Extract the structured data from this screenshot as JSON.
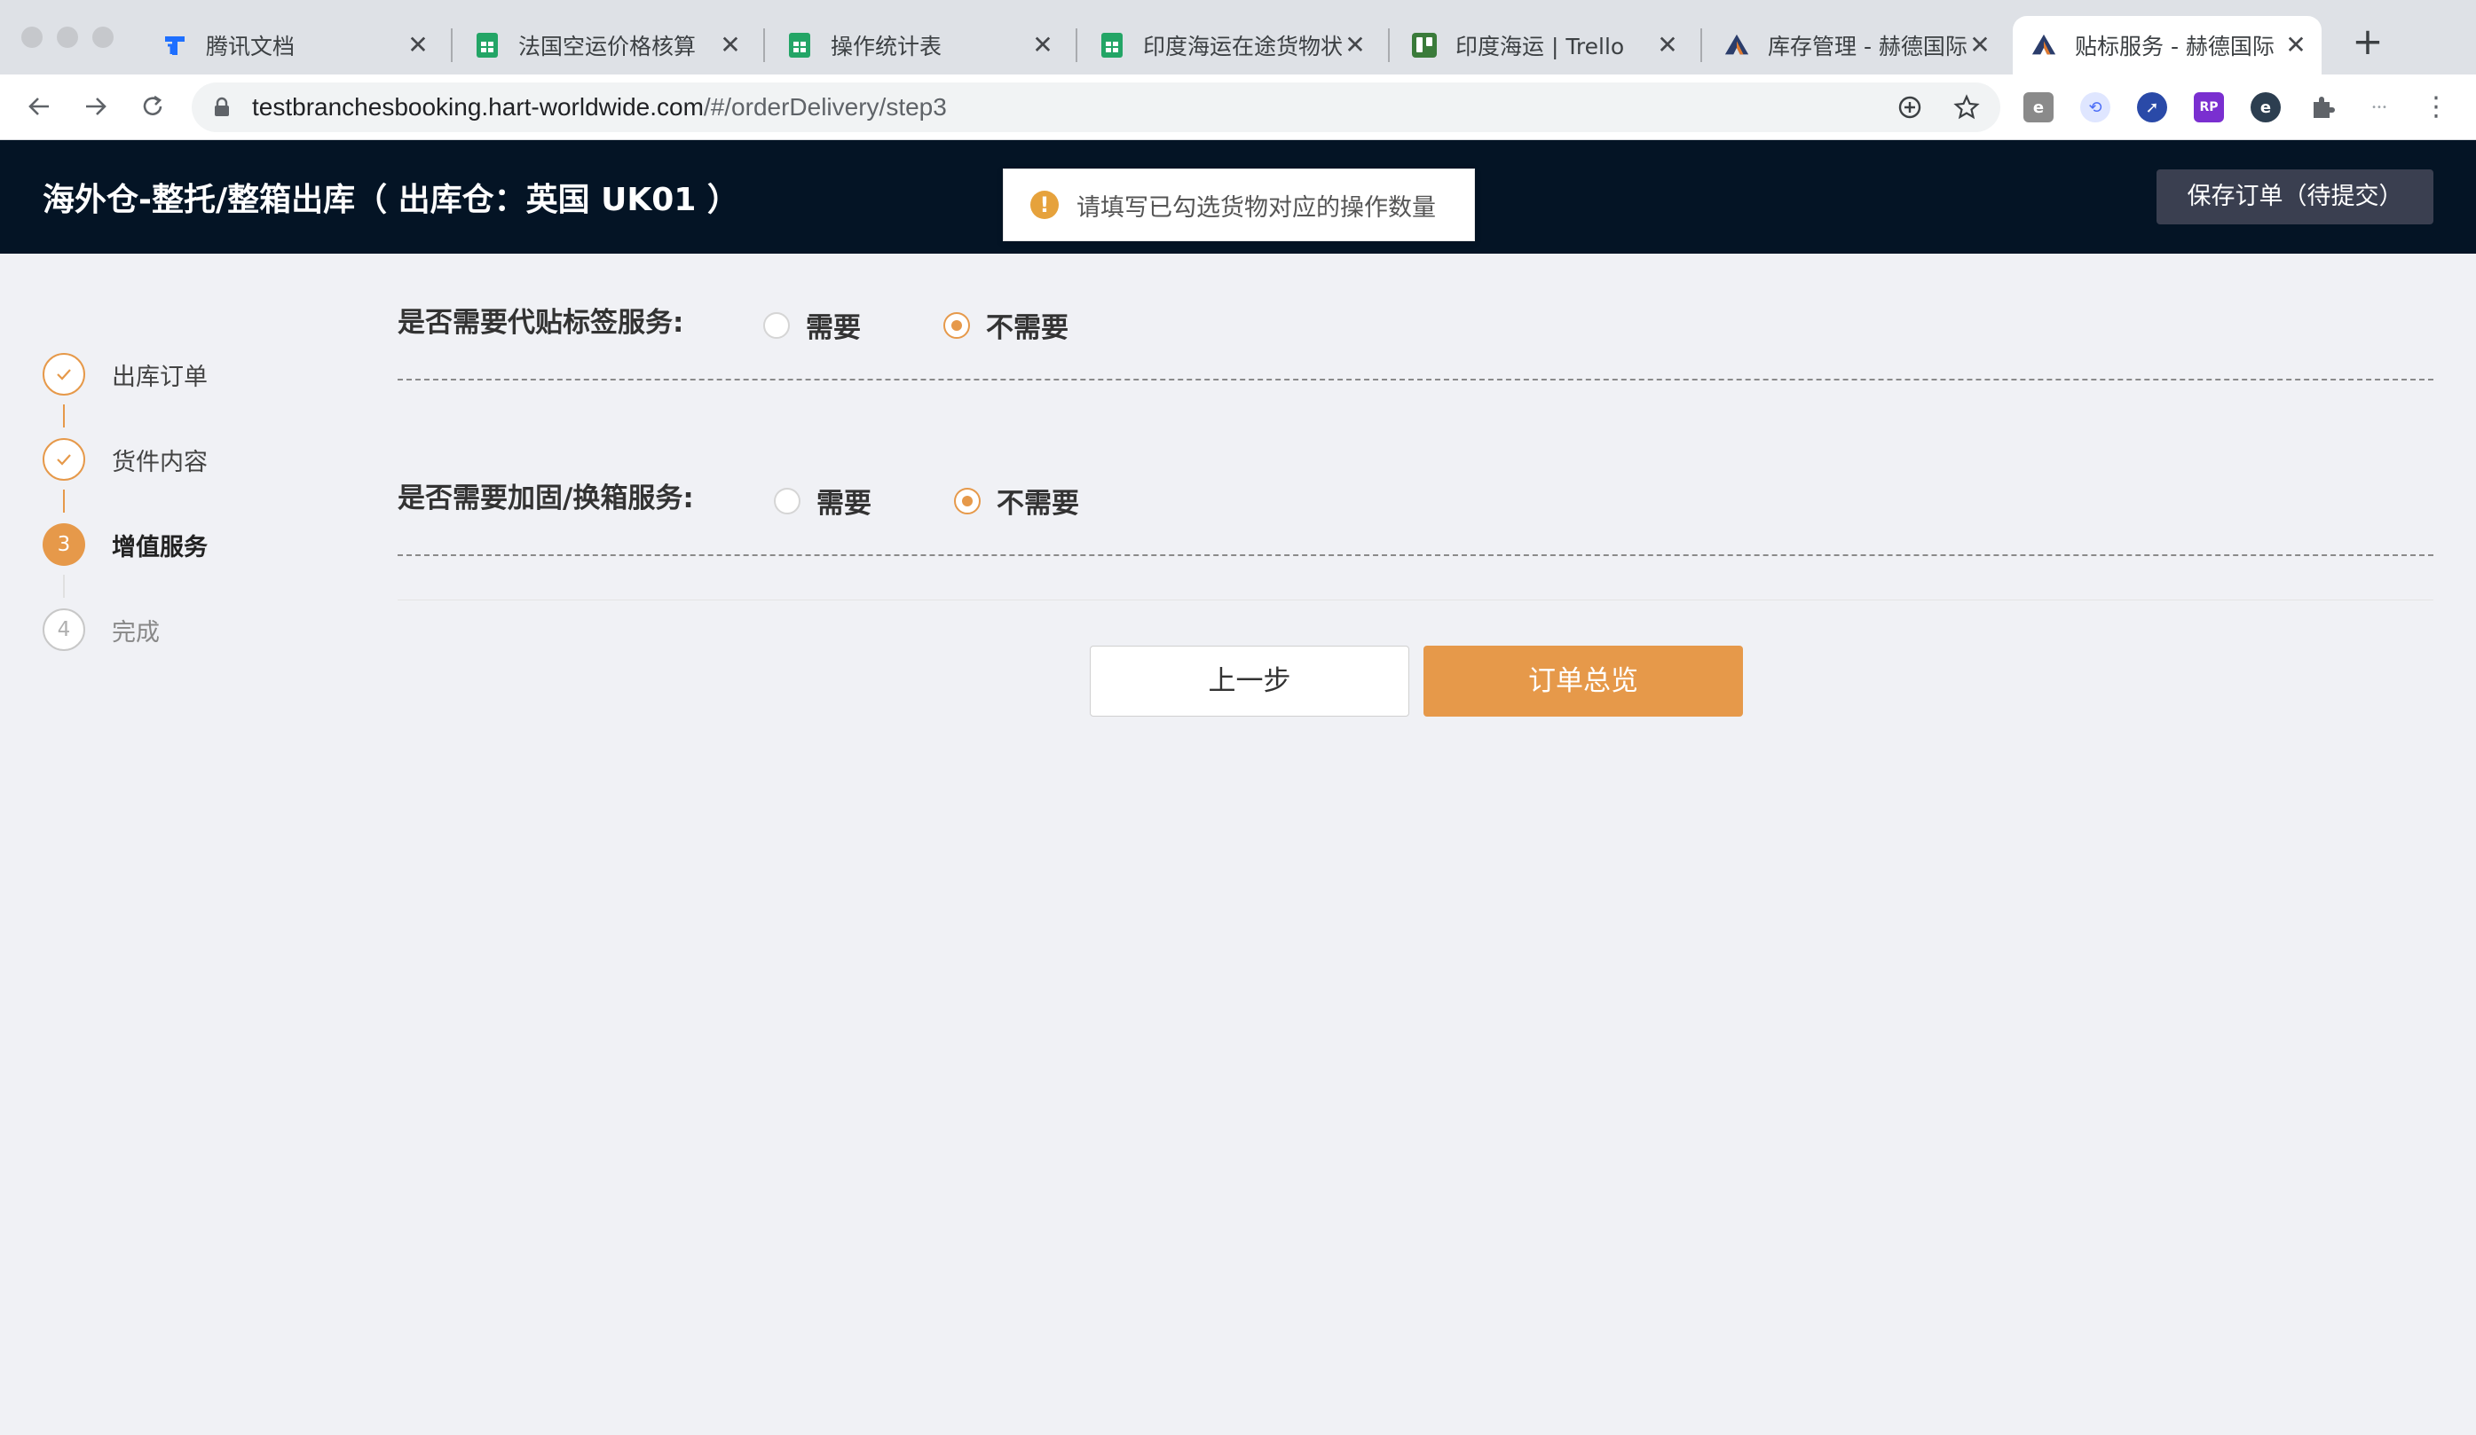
{
  "browser": {
    "tabs": [
      {
        "title": "腾讯文档",
        "icon": "tencent-docs-icon"
      },
      {
        "title": "法国空运价格核算",
        "icon": "sheet-icon"
      },
      {
        "title": "操作统计表",
        "icon": "sheet-icon"
      },
      {
        "title": "印度海运在途货物状",
        "icon": "sheet-icon"
      },
      {
        "title": "印度海运 | Trello",
        "icon": "trello-icon"
      },
      {
        "title": "库存管理 - 赫德国际",
        "icon": "hart-logo-icon"
      },
      {
        "title": "贴标服务 - 赫德国际",
        "icon": "hart-logo-icon"
      }
    ],
    "url_host": "testbranchesbooking.hart-worldwide.com",
    "url_path": "/#/orderDelivery/step3",
    "colors": {
      "tabbar": "#dee1e6",
      "toolbar": "#ffffff"
    }
  },
  "header": {
    "title": "海外仓-整托/整箱出库（ 出库仓：英国 UK01 ）",
    "save_button": "保存订单（待提交）"
  },
  "toast": {
    "icon": "!",
    "message": "请填写已勾选货物对应的操作数量"
  },
  "steps": [
    {
      "label": "出库订单",
      "status": "done",
      "marker": "✓"
    },
    {
      "label": "货件内容",
      "status": "done",
      "marker": "✓"
    },
    {
      "label": "增值服务",
      "status": "current",
      "marker": "3"
    },
    {
      "label": "完成",
      "status": "todo",
      "marker": "4"
    }
  ],
  "form": {
    "label_service": {
      "question": "是否需要代贴标签服务:",
      "options": [
        "需要",
        "不需要"
      ],
      "selected": "不需要"
    },
    "reinforce_service": {
      "question": "是否需要加固/换箱服务:",
      "options": [
        "需要",
        "不需要"
      ],
      "selected": "不需要"
    },
    "prev_button": "上一步",
    "next_button": "订单总览"
  },
  "colors": {
    "accent": "#e6994a",
    "header_bg": "#041425",
    "page_bg": "#f0f1f5",
    "warning": "#e6a23c"
  }
}
